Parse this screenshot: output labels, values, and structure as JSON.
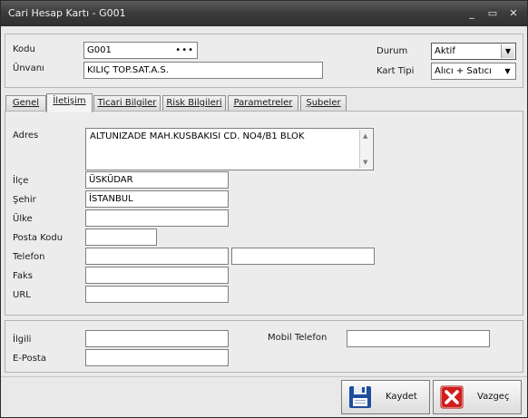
{
  "window": {
    "title": "Cari Hesap Kartı - G001",
    "minimize_glyph": "_",
    "maximize_glyph": "▭",
    "close_glyph": "✕"
  },
  "header": {
    "code_label": "Kodu",
    "code_value": "G001",
    "code_lookup_glyph": "•••",
    "title_label": "Ünvanı",
    "title_value": "KILIÇ TOP.SAT.A.S.",
    "status_label": "Durum",
    "status_value": "Aktif",
    "card_type_label": "Kart Tipi",
    "card_type_value": "Alıcı + Satıcı",
    "dropdown_glyph": "▼"
  },
  "tabs": [
    "Genel",
    "İletişim",
    "Ticari Bilgiler",
    "Risk Bilgileri",
    "Parametreler",
    "Şubeler"
  ],
  "active_tab": "İletişim",
  "contact": {
    "address_label": "Adres",
    "address_value": "ALTUNIZADE MAH.KUSBAKISI CD. NO4/B1 BLOK",
    "district_label": "İlçe",
    "district_value": "ÜSKÜDAR",
    "city_label": "Şehir",
    "city_value": "İSTANBUL",
    "country_label": "Ülke",
    "country_value": "",
    "postcode_label": "Posta Kodu",
    "postcode_value": "",
    "phone_label": "Telefon",
    "phone_value_1": "",
    "phone_value_2": "",
    "fax_label": "Faks",
    "fax_value": "",
    "url_label": "URL",
    "url_value": ""
  },
  "person": {
    "contact_label": "İlgili",
    "contact_value": "",
    "mobile_label": "Mobil Telefon",
    "mobile_value": "",
    "email_label": "E-Posta",
    "email_value": ""
  },
  "footer": {
    "save_label": "Kaydet",
    "cancel_label": "Vazgeç"
  },
  "colors": {
    "save_icon": "#1f4e9c",
    "cancel_icon": "#d21d1d"
  }
}
